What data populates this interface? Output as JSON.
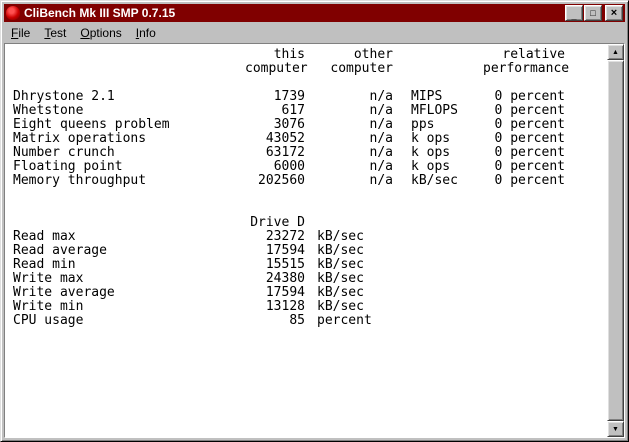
{
  "window": {
    "title": "CliBench Mk III SMP 0.7.15",
    "controls": {
      "minimize": "_",
      "maximize": "□",
      "close": "×"
    }
  },
  "menu": {
    "items": [
      {
        "label": "File"
      },
      {
        "label": "Test"
      },
      {
        "label": "Options"
      },
      {
        "label": "Info"
      }
    ]
  },
  "table": {
    "headers": {
      "this": "this\ncomputer",
      "other": "other\ncomputer",
      "relative": "relative\nperformance"
    },
    "benchmarks": [
      {
        "label": "Dhrystone 2.1",
        "this": "1739",
        "other": "n/a",
        "unit": "MIPS",
        "relative": "0 percent"
      },
      {
        "label": "Whetstone",
        "this": "617",
        "other": "n/a",
        "unit": "MFLOPS",
        "relative": "0 percent"
      },
      {
        "label": "Eight queens problem",
        "this": "3076",
        "other": "n/a",
        "unit": "pps",
        "relative": "0 percent"
      },
      {
        "label": "Matrix operations",
        "this": "43052",
        "other": "n/a",
        "unit": "k ops",
        "relative": "0 percent"
      },
      {
        "label": "Number crunch",
        "this": "63172",
        "other": "n/a",
        "unit": "k ops",
        "relative": "0 percent"
      },
      {
        "label": "Floating point",
        "this": "6000",
        "other": "n/a",
        "unit": "k ops",
        "relative": "0 percent"
      },
      {
        "label": "Memory throughput",
        "this": "202560",
        "other": "n/a",
        "unit": "kB/sec",
        "relative": "0 percent"
      }
    ],
    "drive": {
      "header": "Drive D",
      "rows": [
        {
          "label": "Read max",
          "value": "23272",
          "unit": "kB/sec"
        },
        {
          "label": "Read average",
          "value": "17594",
          "unit": "kB/sec"
        },
        {
          "label": "Read min",
          "value": "15515",
          "unit": "kB/sec"
        },
        {
          "label": "Write max",
          "value": "24380",
          "unit": "kB/sec"
        },
        {
          "label": "Write average",
          "value": "17594",
          "unit": "kB/sec"
        },
        {
          "label": "Write min",
          "value": "13128",
          "unit": "kB/sec"
        },
        {
          "label": "CPU usage",
          "value": "85",
          "unit": "percent"
        }
      ]
    }
  },
  "scrollbar": {
    "up_arrow": "▲",
    "down_arrow": "▼"
  },
  "colors": {
    "titlebar": "#800000",
    "chrome": "#c0c0c0",
    "content_bg": "#ffffff",
    "text": "#000000"
  }
}
